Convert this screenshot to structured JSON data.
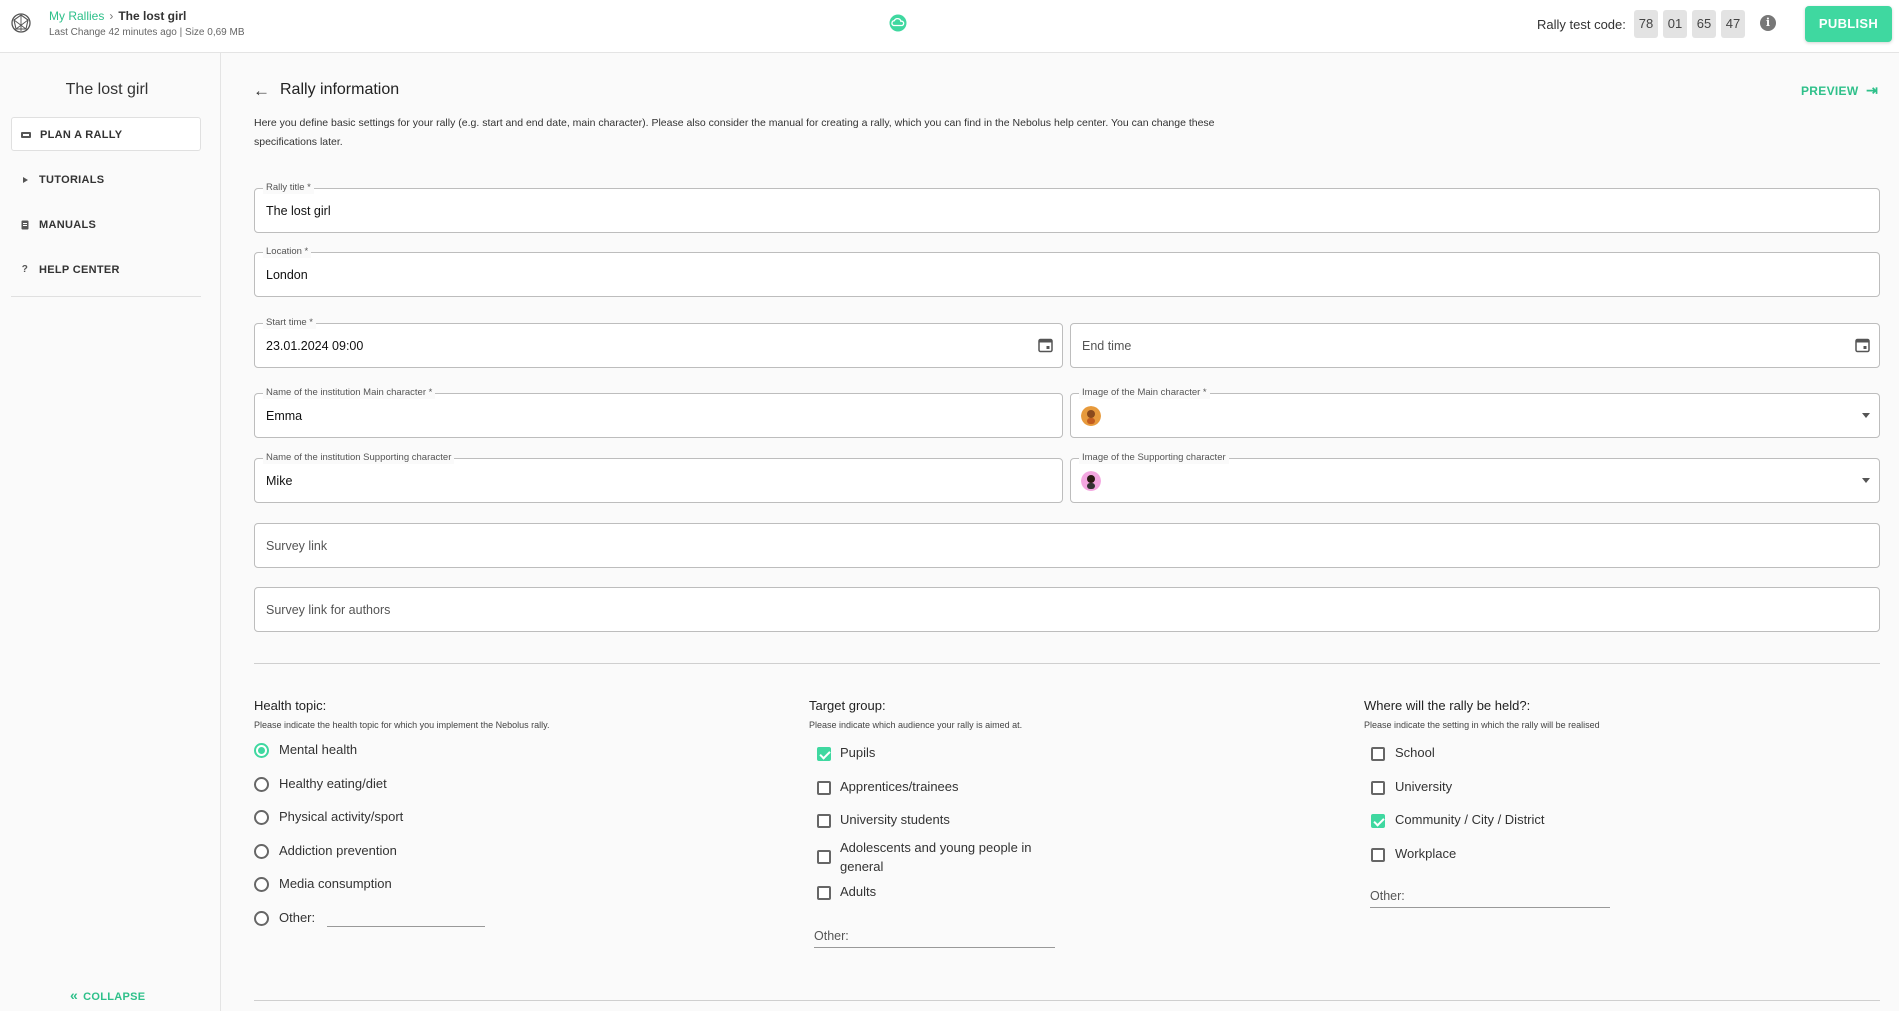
{
  "header": {
    "breadcrumb_root": "My Rallies",
    "breadcrumb_sep": "›",
    "breadcrumb_current": "The lost girl",
    "meta": "Last Change 42 minutes ago | Size 0,69 MB",
    "test_code_label": "Rally test code:",
    "test_code": [
      "78",
      "01",
      "65",
      "47"
    ],
    "publish_label": "PUBLISH",
    "accent_color": "#3fd8a0"
  },
  "sidebar": {
    "title": "The lost girl",
    "items": [
      {
        "label": "PLAN A RALLY",
        "icon": "ticket-icon"
      },
      {
        "label": "TUTORIALS",
        "icon": "play-icon"
      },
      {
        "label": "MANUALS",
        "icon": "document-icon"
      },
      {
        "label": "HELP CENTER",
        "icon": "question-icon"
      }
    ],
    "collapse_label": "COLLAPSE"
  },
  "main": {
    "title": "Rally information",
    "preview_label": "PREVIEW",
    "intro_line1": "Here you define basic settings for your rally (e.g. start and end date, main character). Please also consider the manual for creating a rally, which you can find in the Nebolus help center. You can change these",
    "intro_line2": "specifications later.",
    "fields": {
      "rally_title": {
        "label": "Rally title *",
        "value": "The lost girl"
      },
      "location": {
        "label": "Location *",
        "value": "London"
      },
      "start_time": {
        "label": "Start time *",
        "value": "23.01.2024 09:00"
      },
      "end_time": {
        "placeholder": "End time"
      },
      "main_character_name": {
        "label": "Name of the institution Main character *",
        "value": "Emma"
      },
      "main_character_image": {
        "label": "Image of the Main character *"
      },
      "supporting_character_name": {
        "label": "Name of the institution Supporting character",
        "value": "Mike"
      },
      "supporting_character_image": {
        "label": "Image of the Supporting character"
      },
      "survey_link": {
        "placeholder": "Survey link"
      },
      "survey_link_authors": {
        "placeholder": "Survey link for authors"
      }
    },
    "health_topic": {
      "title": "Health topic:",
      "subtitle": "Please indicate the health topic for which you implement the Nebolus rally.",
      "options": [
        "Mental health",
        "Healthy eating/diet",
        "Physical activity/sport",
        "Addiction prevention",
        "Media consumption",
        "Other:"
      ],
      "selected": "Mental health"
    },
    "target_group": {
      "title": "Target group:",
      "subtitle": "Please indicate which audience your rally is aimed at.",
      "options": [
        "Pupils",
        "Apprentices/trainees",
        "University students",
        "Adolescents and young people in",
        "general",
        "Adults"
      ],
      "checked": [
        "Pupils"
      ],
      "other_label": "Other:"
    },
    "location_setting": {
      "title": "Where will the rally be held?:",
      "subtitle": "Please indicate the setting in which the rally will be realised",
      "options": [
        "School",
        "University",
        "Community / City / District",
        "Workplace"
      ],
      "checked": [
        "Community / City / District"
      ],
      "other_label": "Other:"
    }
  }
}
